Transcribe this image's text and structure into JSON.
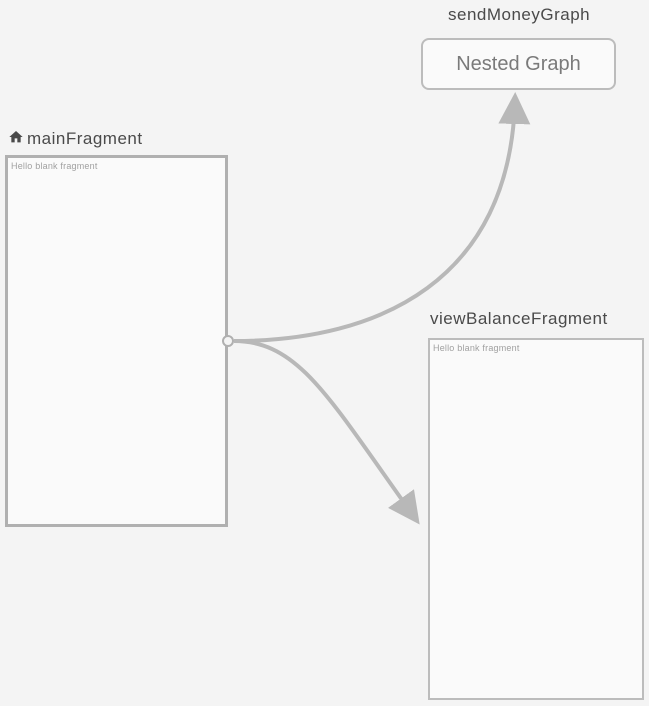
{
  "nodes": {
    "sendMoneyGraph": {
      "label": "sendMoneyGraph",
      "boxText": "Nested Graph"
    },
    "mainFragment": {
      "label": "mainFragment",
      "innerText": "Hello blank fragment",
      "isStartDestination": true
    },
    "viewBalanceFragment": {
      "label": "viewBalanceFragment",
      "innerText": "Hello blank fragment"
    }
  },
  "connections": [
    {
      "from": "mainFragment",
      "to": "sendMoneyGraph"
    },
    {
      "from": "mainFragment",
      "to": "viewBalanceFragment"
    }
  ]
}
